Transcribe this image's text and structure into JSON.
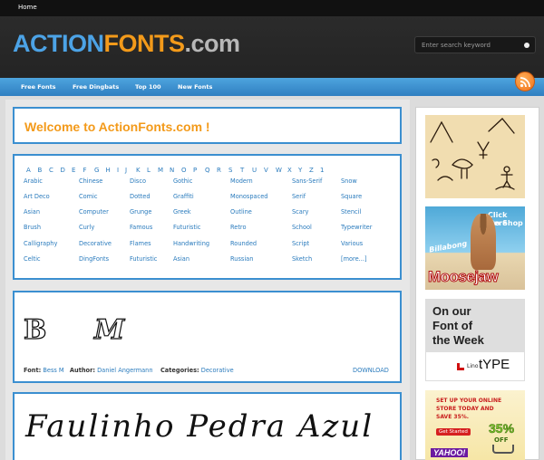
{
  "topbar": {
    "home": "Home"
  },
  "logo": {
    "part1": "ACTION",
    "part2": "FONTS",
    "part3": ".com"
  },
  "search": {
    "placeholder": "Enter search keyword"
  },
  "nav": [
    "Free Fonts",
    "Free Dingbats",
    "Top 100",
    "New Fonts"
  ],
  "welcome": {
    "title": "Welcome to ActionFonts.com !"
  },
  "letters": [
    "A",
    "B",
    "C",
    "D",
    "E",
    "F",
    "G",
    "H",
    "I",
    "J",
    "K",
    "L",
    "M",
    "N",
    "O",
    "P",
    "Q",
    "R",
    "S",
    "T",
    "U",
    "V",
    "W",
    "X",
    "Y",
    "Z",
    "1"
  ],
  "categories": [
    [
      "Arabic",
      "Art Deco",
      "Asian",
      "Brush",
      "Calligraphy",
      "Celtic"
    ],
    [
      "Chinese",
      "Comic",
      "Computer",
      "Curly",
      "Decorative",
      "DingFonts"
    ],
    [
      "Disco",
      "Dotted",
      "Grunge",
      "Famous",
      "Flames",
      "Futuristic"
    ],
    [
      "Gothic",
      "Graffiti",
      "Greek",
      "Futuristic",
      "Handwriting",
      "Asian"
    ],
    [
      "Modern",
      "Monospaced",
      "Outline",
      "Retro",
      "Rounded",
      "Russian"
    ],
    [
      "Sans-Serif",
      "Serif",
      "Scary",
      "School",
      "Script",
      "Sketch"
    ],
    [
      "Snow",
      "Square",
      "Stencil",
      "Typewriter",
      "Various",
      "[more...]"
    ]
  ],
  "font1": {
    "font_label": "Font:",
    "font_name": "Bess M",
    "author_label": "Author:",
    "author_name": "Daniel Angermann",
    "categories_label": "Categories:",
    "category": "Decorative",
    "download": "DOWNLOAD",
    "preview_glyphs": [
      "B",
      "M"
    ]
  },
  "font2": {
    "preview": "Faulinho Pedra Azul"
  },
  "sidebar": {
    "ad2": {
      "brand": "Billabong",
      "cta_line1": "Click Here",
      "cta_line2": "to Shop",
      "store": "Moosejaw"
    },
    "ad3": {
      "line1": "On our",
      "line2": "Font of",
      "line3": "the Week",
      "brand_prefix": "Lino",
      "brand": "tYPE"
    },
    "ad4": {
      "line1": "SET UP YOUR ONLINE",
      "line2": "STORE TODAY AND",
      "line3": "SAVE 35%.",
      "button": "Get Started",
      "badge": "35%",
      "badge_sub": "OFF",
      "brand": "YAHOO!"
    }
  },
  "colors": {
    "accent_blue": "#3b8fd0",
    "accent_orange": "#f39a1a",
    "nav_blue": "#2f7fc1"
  }
}
